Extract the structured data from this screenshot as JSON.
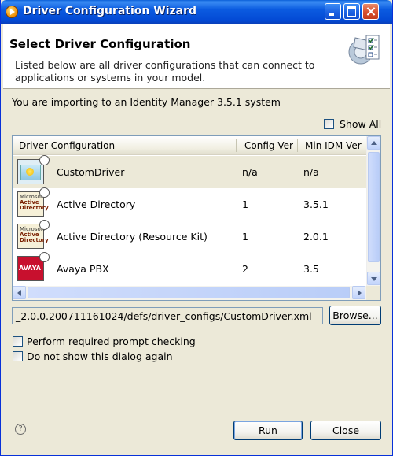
{
  "window": {
    "title": "Driver Configuration Wizard"
  },
  "header": {
    "title": "Select Driver Configuration",
    "description": "Listed below are all driver configurations that can connect to applications or systems in your model."
  },
  "import_info": "You are importing to an Identity Manager 3.5.1 system",
  "show_all": {
    "label": "Show All",
    "checked": false
  },
  "table": {
    "columns": [
      "Driver Configuration",
      "Config Ver",
      "Min IDM Ver"
    ],
    "rows": [
      {
        "name": "CustomDriver",
        "config_ver": "n/a",
        "min_idm_ver": "n/a",
        "icon": "custom-driver-icon",
        "selected": true
      },
      {
        "name": "Active Directory",
        "config_ver": "1",
        "min_idm_ver": "3.5.1",
        "icon": "microsoft-active-directory-icon",
        "selected": false
      },
      {
        "name": "Active Directory (Resource Kit)",
        "config_ver": "1",
        "min_idm_ver": "2.0.1",
        "icon": "microsoft-active-directory-icon",
        "selected": false
      },
      {
        "name": "Avaya PBX",
        "config_ver": "2",
        "min_idm_ver": "3.5",
        "icon": "avaya-icon",
        "selected": false
      }
    ],
    "icon_text": {
      "ms_line1": "Microsoft",
      "ms_line2": "Active",
      "ms_line3": "Directory",
      "avaya": "AVAYA"
    }
  },
  "path": "_2.0.0.200711161024/defs/driver_configs/CustomDriver.xml",
  "browse_label": "Browse...",
  "options": [
    {
      "label": "Perform required prompt checking",
      "checked": false
    },
    {
      "label": "Do not show this dialog again",
      "checked": false
    }
  ],
  "footer": {
    "run_label": "Run",
    "close_label": "Close",
    "help_glyph": "?"
  }
}
